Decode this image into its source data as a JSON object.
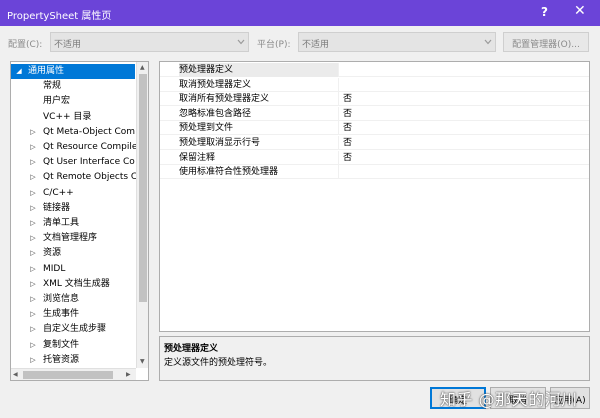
{
  "window": {
    "title": "PropertySheet 属性页",
    "help_glyph": "?",
    "close_glyph": "✕",
    "accent_color": "#6b44d8"
  },
  "config_bar": {
    "config_label": "配置(C):",
    "config_value": "不适用",
    "platform_label": "平台(P):",
    "platform_value": "不适用",
    "manager_button": "配置管理器(O)..."
  },
  "tree": {
    "items": [
      {
        "label": "通用属性",
        "expander": "◢",
        "level": 0,
        "selected": true
      },
      {
        "label": "常规",
        "expander": "",
        "level": 1
      },
      {
        "label": "用户宏",
        "expander": "",
        "level": 1
      },
      {
        "label": "VC++ 目录",
        "expander": "",
        "level": 1
      },
      {
        "label": "Qt Meta-Object Com",
        "expander": "▷",
        "level": 1
      },
      {
        "label": "Qt Resource Compile",
        "expander": "▷",
        "level": 1
      },
      {
        "label": "Qt User Interface Co",
        "expander": "▷",
        "level": 1
      },
      {
        "label": "Qt Remote Objects C",
        "expander": "▷",
        "level": 1
      },
      {
        "label": "C/C++",
        "expander": "▷",
        "level": 1
      },
      {
        "label": "链接器",
        "expander": "▷",
        "level": 1
      },
      {
        "label": "清单工具",
        "expander": "▷",
        "level": 1
      },
      {
        "label": "文档管理程序",
        "expander": "▷",
        "level": 1
      },
      {
        "label": "资源",
        "expander": "▷",
        "level": 1
      },
      {
        "label": "MIDL",
        "expander": "▷",
        "level": 1
      },
      {
        "label": "XML 文档生成器",
        "expander": "▷",
        "level": 1
      },
      {
        "label": "浏览信息",
        "expander": "▷",
        "level": 1
      },
      {
        "label": "生成事件",
        "expander": "▷",
        "level": 1
      },
      {
        "label": "自定义生成步骤",
        "expander": "▷",
        "level": 1
      },
      {
        "label": "复制文件",
        "expander": "▷",
        "level": 1
      },
      {
        "label": "托管资源",
        "expander": "▷",
        "level": 1
      }
    ]
  },
  "properties": {
    "rows": [
      {
        "name": "预处理器定义",
        "value": "",
        "selected": true
      },
      {
        "name": "取消预处理器定义",
        "value": ""
      },
      {
        "name": "取消所有预处理器定义",
        "value": "否"
      },
      {
        "name": "忽略标准包含路径",
        "value": "否"
      },
      {
        "name": "预处理到文件",
        "value": "否"
      },
      {
        "name": "预处理取消显示行号",
        "value": "否"
      },
      {
        "name": "保留注释",
        "value": "否"
      },
      {
        "name": "使用标准符合性预处理器",
        "value": ""
      }
    ]
  },
  "description": {
    "title": "预处理器定义",
    "text": "定义源文件的预处理符号。"
  },
  "buttons": {
    "ok": "确定",
    "cancel": "取消",
    "apply": "应用(A)"
  },
  "watermark": "知乎 @那天的河川"
}
